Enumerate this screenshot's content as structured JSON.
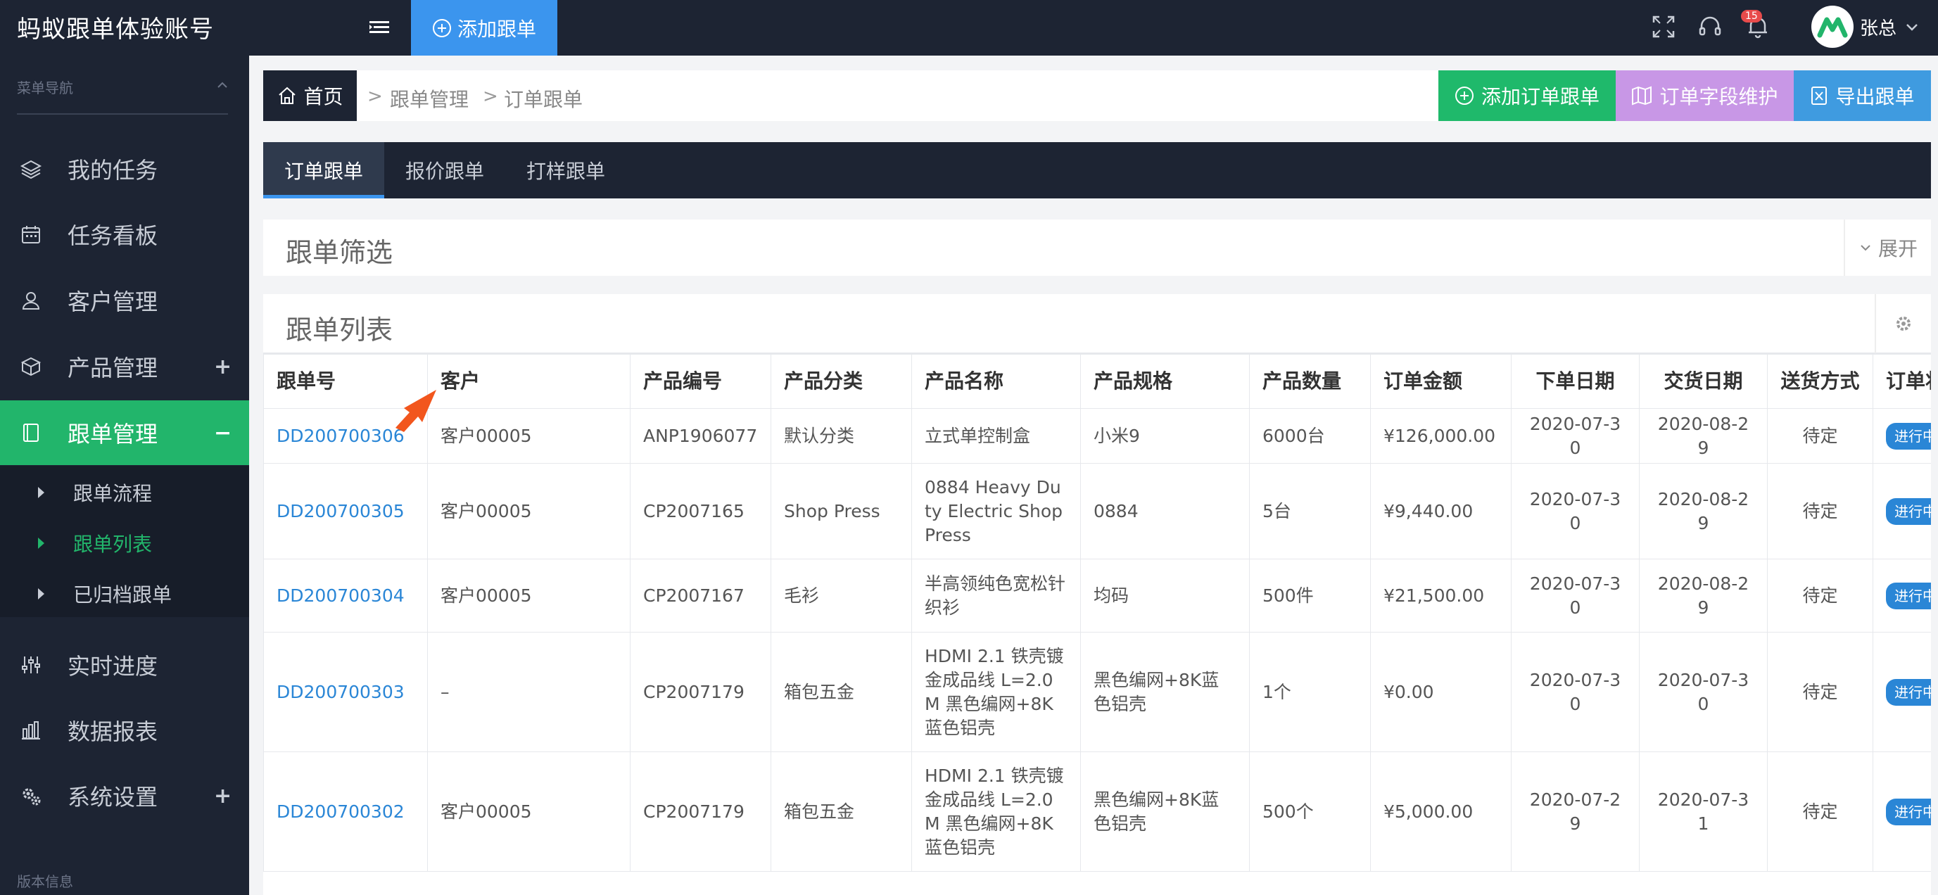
{
  "app": {
    "title": "蚂蚁跟单体验账号"
  },
  "topbar": {
    "add_tab_label": "添加跟单",
    "notification_count": "15",
    "user_name": "张总"
  },
  "sidebar": {
    "header": "菜单导航",
    "items": [
      {
        "label": "我的任务",
        "icon": "layers-icon"
      },
      {
        "label": "任务看板",
        "icon": "calendar-icon"
      },
      {
        "label": "客户管理",
        "icon": "user-icon"
      },
      {
        "label": "产品管理",
        "icon": "box-icon",
        "expander": "+"
      },
      {
        "label": "跟单管理",
        "icon": "document-icon",
        "expander": "−",
        "active": true
      },
      {
        "label": "实时进度",
        "icon": "sliders-icon"
      },
      {
        "label": "数据报表",
        "icon": "bar-chart-icon"
      },
      {
        "label": "系统设置",
        "icon": "gears-icon",
        "expander": "+"
      }
    ],
    "sub_items": [
      {
        "label": "跟单流程"
      },
      {
        "label": "跟单列表",
        "active": true
      },
      {
        "label": "已归档跟单"
      }
    ],
    "version_label": "版本信息"
  },
  "breadcrumb": {
    "home": "首页",
    "level1": "跟单管理",
    "level2": "订单跟单",
    "separator": ">"
  },
  "actions": {
    "add_order": "添加订单跟单",
    "field_maintain": "订单字段维护",
    "export": "导出跟单"
  },
  "tabs": [
    "订单跟单",
    "报价跟单",
    "打样跟单"
  ],
  "filter": {
    "title": "跟单筛选",
    "expand_label": "展开"
  },
  "list": {
    "title": "跟单列表",
    "columns": [
      "跟单号",
      "客户",
      "产品编号",
      "产品分类",
      "产品名称",
      "产品规格",
      "产品数量",
      "订单金额",
      "下单日期",
      "交货日期",
      "送货方式",
      "订单状态"
    ],
    "rows": [
      {
        "order_no": "DD200700306",
        "customer": "客户00005",
        "product_code": "ANP1906077",
        "category": "默认分类",
        "name": "立式单控制盒",
        "spec": "小米9",
        "qty": "6000台",
        "amount": "¥126,000.00",
        "order_date": "2020-07-30",
        "delivery_date": "2020-08-29",
        "shipping": "待定",
        "status": "进行中"
      },
      {
        "order_no": "DD200700305",
        "customer": "客户00005",
        "product_code": "CP2007165",
        "category": "Shop Press",
        "name": "0884 Heavy Duty Electric Shop Press",
        "spec": "0884",
        "qty": "5台",
        "amount": "¥9,440.00",
        "order_date": "2020-07-30",
        "delivery_date": "2020-08-29",
        "shipping": "待定",
        "status": "进行中"
      },
      {
        "order_no": "DD200700304",
        "customer": "客户00005",
        "product_code": "CP2007167",
        "category": "毛衫",
        "name": "半高领纯色宽松针织衫",
        "spec": "均码",
        "qty": "500件",
        "amount": "¥21,500.00",
        "order_date": "2020-07-30",
        "delivery_date": "2020-08-29",
        "shipping": "待定",
        "status": "进行中"
      },
      {
        "order_no": "DD200700303",
        "customer": "–",
        "product_code": "CP2007179",
        "category": "箱包五金",
        "name": "HDMI 2.1 铁壳镀金成品线 L=2.0M 黑色编网+8K蓝色铝壳",
        "spec": "黑色编网+8K蓝色铝壳",
        "qty": "1个",
        "amount": "¥0.00",
        "order_date": "2020-07-30",
        "delivery_date": "2020-07-30",
        "shipping": "待定",
        "status": "进行中"
      },
      {
        "order_no": "DD200700302",
        "customer": "客户00005",
        "product_code": "CP2007179",
        "category": "箱包五金",
        "name": "HDMI 2.1 铁壳镀金成品线 L=2.0M 黑色编网+8K蓝色铝壳",
        "spec": "黑色编网+8K蓝色铝壳",
        "qty": "500个",
        "amount": "¥5,000.00",
        "order_date": "2020-07-29",
        "delivery_date": "2020-07-31",
        "shipping": "待定",
        "status": "进行中"
      }
    ]
  },
  "colors": {
    "dark_bg": "#1d2433",
    "accent_green": "#22b56b",
    "accent_blue": "#3b95ee",
    "add_button": "#1fb96b",
    "field_button": "#c897e6",
    "export_button": "#3f9be0",
    "link": "#2a86d6",
    "annotation_arrow": "#f2561d"
  }
}
